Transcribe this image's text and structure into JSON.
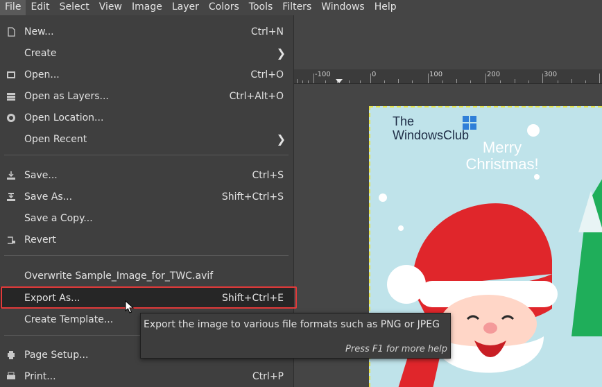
{
  "menubar": {
    "items": [
      {
        "label": "File",
        "active": true
      },
      {
        "label": "Edit"
      },
      {
        "label": "Select"
      },
      {
        "label": "View"
      },
      {
        "label": "Image"
      },
      {
        "label": "Layer"
      },
      {
        "label": "Colors"
      },
      {
        "label": "Tools"
      },
      {
        "label": "Filters"
      },
      {
        "label": "Windows"
      },
      {
        "label": "Help"
      }
    ]
  },
  "file_menu": {
    "items": [
      {
        "label": "New...",
        "shortcut": "Ctrl+N",
        "icon": "new-document-icon"
      },
      {
        "label": "Create",
        "submenu": true
      },
      {
        "label": "Open...",
        "shortcut": "Ctrl+O",
        "icon": "open-image-icon"
      },
      {
        "label": "Open as Layers...",
        "shortcut": "Ctrl+Alt+O",
        "icon": "layers-icon"
      },
      {
        "label": "Open Location...",
        "icon": "globe-icon"
      },
      {
        "label": "Open Recent",
        "submenu": true
      },
      {
        "label": "Save...",
        "shortcut": "Ctrl+S",
        "icon": "save-icon"
      },
      {
        "label": "Save As...",
        "shortcut": "Shift+Ctrl+S",
        "icon": "save-as-icon"
      },
      {
        "label": "Save a Copy..."
      },
      {
        "label": "Revert",
        "icon": "revert-icon"
      },
      {
        "label": "Overwrite Sample_Image_for_TWC.avif"
      },
      {
        "label": "Export As...",
        "shortcut": "Shift+Ctrl+E",
        "highlighted": true
      },
      {
        "label": "Create Template..."
      },
      {
        "label": "Page Setup...",
        "icon": "page-setup-icon"
      },
      {
        "label": "Print...",
        "shortcut": "Ctrl+P",
        "icon": "print-icon"
      }
    ]
  },
  "tooltip": {
    "text": "Export the image to various file formats such as PNG or JPEG",
    "help": "Press F1 for more help"
  },
  "ruler": {
    "labels": [
      "-100",
      "0",
      "100",
      "200",
      "300"
    ]
  },
  "canvas": {
    "brand_line1": "The",
    "brand_line2": "WindowsClub",
    "greeting_line1": "Merry",
    "greeting_line2": "Christmas!"
  },
  "colors": {
    "highlight_box": "#e23a3a",
    "menu_bg": "#3f3f3f",
    "selection_border": "#e6e24a"
  }
}
